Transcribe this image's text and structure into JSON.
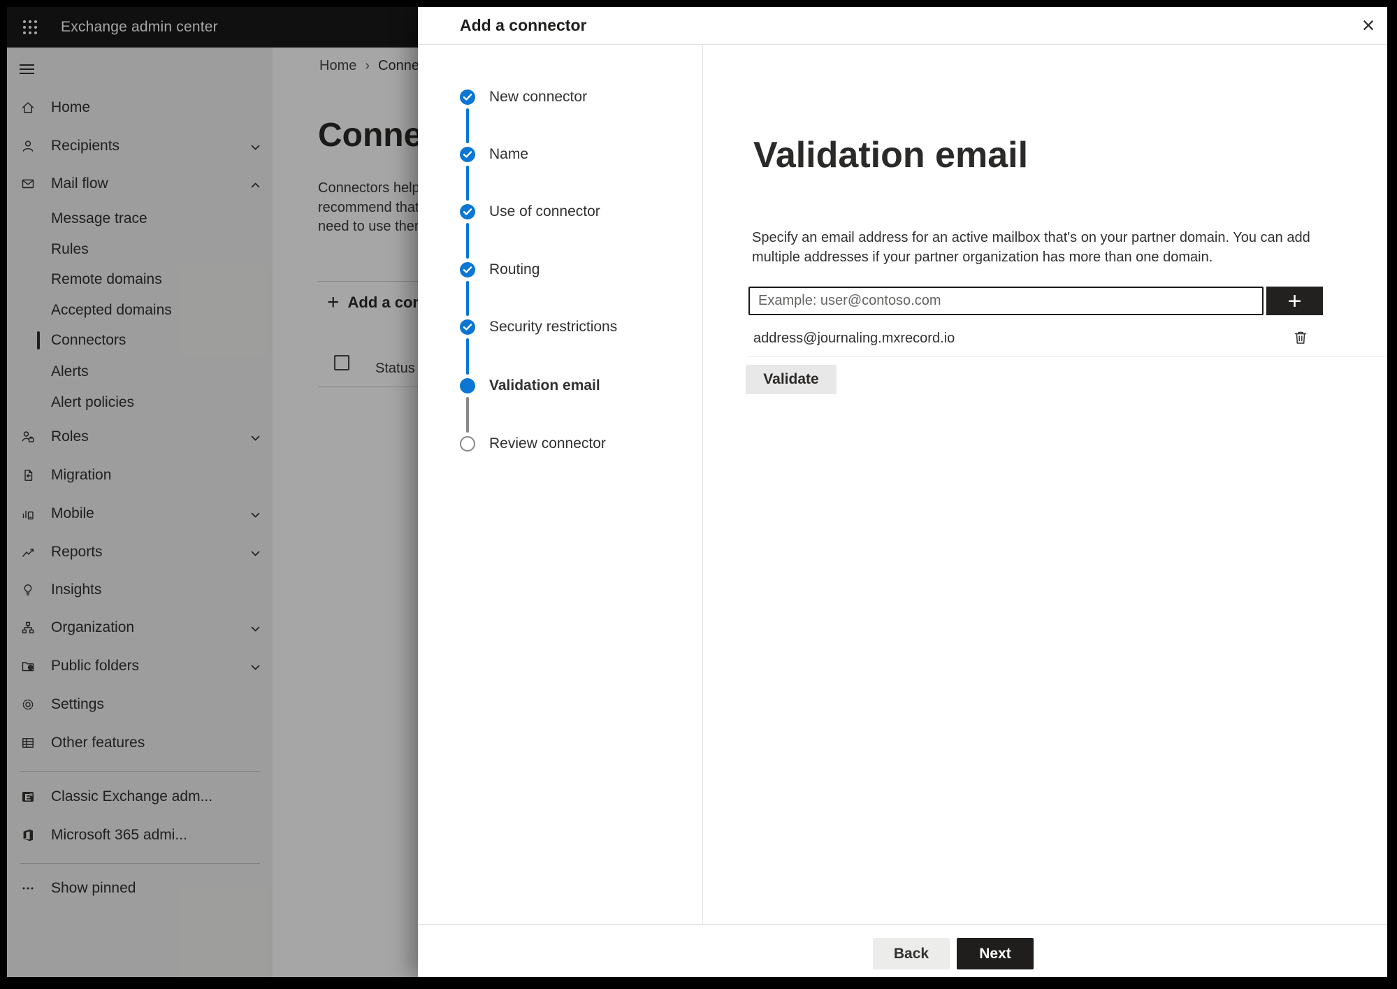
{
  "topbar": {
    "title": "Exchange admin center"
  },
  "sidebar": {
    "items": [
      {
        "label": "Home",
        "icon": "home-icon"
      },
      {
        "label": "Recipients",
        "icon": "person-icon",
        "chevron": "down"
      },
      {
        "label": "Mail flow",
        "icon": "mail-icon",
        "chevron": "up",
        "expanded": true
      },
      {
        "label": "Message trace",
        "indent": true
      },
      {
        "label": "Rules",
        "indent": true
      },
      {
        "label": "Remote domains",
        "indent": true
      },
      {
        "label": "Accepted domains",
        "indent": true
      },
      {
        "label": "Connectors",
        "indent": true,
        "selected": true
      },
      {
        "label": "Alerts",
        "indent": true
      },
      {
        "label": "Alert policies",
        "indent": true
      },
      {
        "label": "Roles",
        "icon": "roles-icon",
        "chevron": "down"
      },
      {
        "label": "Migration",
        "icon": "migration-icon"
      },
      {
        "label": "Mobile",
        "icon": "mobile-icon",
        "chevron": "down"
      },
      {
        "label": "Reports",
        "icon": "reports-icon",
        "chevron": "down"
      },
      {
        "label": "Insights",
        "icon": "insights-icon"
      },
      {
        "label": "Organization",
        "icon": "organization-icon",
        "chevron": "down"
      },
      {
        "label": "Public folders",
        "icon": "public-folders-icon",
        "chevron": "down"
      },
      {
        "label": "Settings",
        "icon": "settings-icon"
      },
      {
        "label": "Other features",
        "icon": "other-features-icon"
      },
      {
        "label": "Classic Exchange adm...",
        "icon": "classic-exchange-icon"
      },
      {
        "label": "Microsoft 365 admi...",
        "icon": "microsoft-365-icon"
      },
      {
        "label": "Show pinned",
        "icon": "ellipsis-icon"
      }
    ]
  },
  "backdrop": {
    "breadcrumb": {
      "home": "Home",
      "separator": "›",
      "current": "Conne"
    },
    "page_title": "Connect",
    "description_lines": [
      "Connectors help",
      "recommend that",
      "need to use ther"
    ],
    "add_button_label": "Add a conn",
    "add_button_plus": "+",
    "table": {
      "status_header": "Status"
    }
  },
  "modal": {
    "title": "Add a connector",
    "close_glyph": "×",
    "steps": [
      {
        "label": "New connector",
        "state": "completed"
      },
      {
        "label": "Name",
        "state": "completed"
      },
      {
        "label": "Use of connector",
        "state": "completed"
      },
      {
        "label": "Routing",
        "state": "completed"
      },
      {
        "label": "Security restrictions",
        "state": "completed"
      },
      {
        "label": "Validation email",
        "state": "active"
      },
      {
        "label": "Review connector",
        "state": "upcoming"
      }
    ],
    "content": {
      "heading": "Validation email",
      "description": "Specify an email address for an active mailbox that's on your partner domain. You can add multiple addresses if your partner organization has more than one domain.",
      "email_input": {
        "value": "",
        "placeholder": "Example: user@contoso.com"
      },
      "add_address_button": "+",
      "addresses": [
        {
          "email": "address@journaling.mxrecord.io"
        }
      ],
      "validate_button": "Validate"
    },
    "footer": {
      "back_button": "Back",
      "next_button": "Next"
    }
  },
  "colors": {
    "accent_blue": "#0b76d4",
    "dark_button": "#1f1e1d",
    "topbar_bg": "#1b1a19",
    "inactive_step_gray": "#8a8886"
  }
}
